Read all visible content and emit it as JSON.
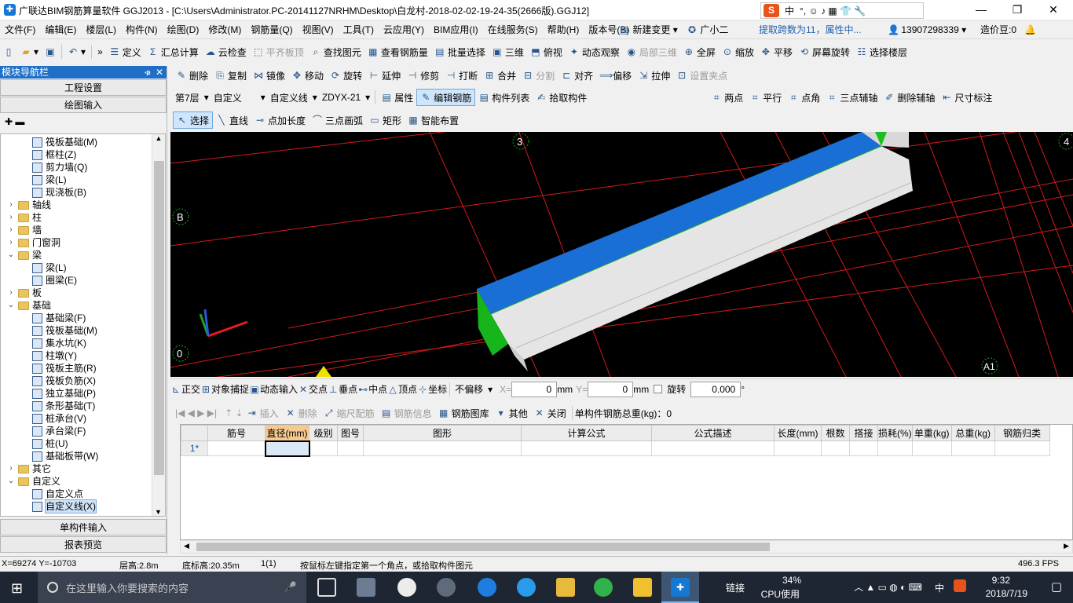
{
  "titlebar": {
    "title": "广联达BIM钢筋算量软件 GGJ2013 - [C:\\Users\\Administrator.PC-20141127NRHM\\Desktop\\白龙村-2018-02-02-19-24-35(2666版).GGJ12]",
    "ime_label": "中",
    "ime_extra": "°, ☺ ♪ ▦ 👕 🔧",
    "min": "—",
    "max": "❐",
    "close": "✕"
  },
  "menubar": {
    "items": [
      "文件(F)",
      "编辑(E)",
      "楼层(L)",
      "构件(N)",
      "绘图(D)",
      "修改(M)",
      "钢筋量(Q)",
      "视图(V)",
      "工具(T)",
      "云应用(Y)",
      "BIM应用(I)",
      "在线服务(S)",
      "帮助(H)",
      "版本号(B)"
    ],
    "new_change": "新建变更",
    "assistant": "广小二",
    "notice": "提取跨数为11，属性中...",
    "phone": "13907298339",
    "cost_bean": "造价豆:0"
  },
  "toolbar1": {
    "items": [
      "定义",
      "汇总计算",
      "云检查",
      "平齐板顶",
      "查找图元",
      "查看钢筋量",
      "批量选择",
      "三维",
      "俯视",
      "动态观察",
      "局部三维",
      "全屏",
      "缩放",
      "平移",
      "屏幕旋转",
      "选择楼层"
    ]
  },
  "toolbar2": {
    "items": [
      "删除",
      "复制",
      "镜像",
      "移动",
      "旋转",
      "延伸",
      "修剪",
      "打断",
      "合并",
      "分割",
      "对齐",
      "偏移",
      "拉伸",
      "设置夹点"
    ]
  },
  "toolbar3": {
    "floor": "第7层",
    "category": "自定义",
    "type": "自定义线",
    "component": "ZDYX-21",
    "items": [
      "属性",
      "编辑钢筋",
      "构件列表",
      "拾取构件"
    ],
    "snap_items": [
      "两点",
      "平行",
      "点角",
      "三点辅轴",
      "删除辅轴",
      "尺寸标注"
    ]
  },
  "toolbar4": {
    "items": [
      "选择",
      "直线",
      "点加长度",
      "三点画弧",
      "矩形",
      "智能布置"
    ]
  },
  "nav": {
    "title": "模块导航栏",
    "pin": "ቁ",
    "close": "✕",
    "project_settings": "工程设置",
    "drawing_input": "绘图输入",
    "single_input": "单构件输入",
    "report_preview": "报表预览",
    "tree": [
      {
        "label": "筏板基础(M)",
        "level": 3
      },
      {
        "label": "框柱(Z)",
        "level": 3
      },
      {
        "label": "剪力墙(Q)",
        "level": 3
      },
      {
        "label": "梁(L)",
        "level": 3
      },
      {
        "label": "现浇板(B)",
        "level": 3
      },
      {
        "label": "轴线",
        "level": 1
      },
      {
        "label": "柱",
        "level": 1
      },
      {
        "label": "墙",
        "level": 1
      },
      {
        "label": "门窗洞",
        "level": 1
      },
      {
        "label": "梁",
        "level": 1
      },
      {
        "label": "梁(L)",
        "level": 3
      },
      {
        "label": "圈梁(E)",
        "level": 3
      },
      {
        "label": "板",
        "level": 1
      },
      {
        "label": "基础",
        "level": 1
      },
      {
        "label": "基础梁(F)",
        "level": 3
      },
      {
        "label": "筏板基础(M)",
        "level": 3
      },
      {
        "label": "集水坑(K)",
        "level": 3
      },
      {
        "label": "柱墩(Y)",
        "level": 3
      },
      {
        "label": "筏板主筋(R)",
        "level": 3
      },
      {
        "label": "筏板负筋(X)",
        "level": 3
      },
      {
        "label": "独立基础(P)",
        "level": 3
      },
      {
        "label": "条形基础(T)",
        "level": 3
      },
      {
        "label": "桩承台(V)",
        "level": 3
      },
      {
        "label": "承台梁(F)",
        "level": 3
      },
      {
        "label": "桩(U)",
        "level": 3
      },
      {
        "label": "基础板带(W)",
        "level": 3
      },
      {
        "label": "其它",
        "level": 1
      },
      {
        "label": "自定义",
        "level": 1
      },
      {
        "label": "自定义点",
        "level": 3
      },
      {
        "label": "自定义线(X)",
        "level": 3
      }
    ]
  },
  "viewport": {
    "axis_labels": [
      "3",
      "B",
      "0",
      "4",
      "A1"
    ]
  },
  "snapbar": {
    "items": [
      "正交",
      "对象捕捉",
      "动态输入",
      "交点",
      "垂点",
      "中点",
      "顶点",
      "坐标"
    ],
    "offset_mode": "不偏移",
    "x_label": "X=",
    "x_value": "0",
    "y_label": "Y=",
    "y_value": "0",
    "unit": "mm",
    "rotate_label": "旋转",
    "rotate_value": "0.000",
    "degree": "°"
  },
  "rebarbar": {
    "items": [
      "插入",
      "删除",
      "缩尺配筋",
      "钢筋信息",
      "钢筋图库",
      "其他",
      "关闭"
    ],
    "total": "单构件钢筋总重(kg)：0"
  },
  "grid": {
    "columns": [
      "筋号",
      "直径(mm)",
      "级别",
      "图号",
      "图形",
      "计算公式",
      "公式描述",
      "长度(mm)",
      "根数",
      "搭接",
      "损耗(%)",
      "单重(kg)",
      "总重(kg)",
      "钢筋归类"
    ],
    "rows": [
      {
        "index": "1*"
      }
    ]
  },
  "statusbar": {
    "coords": "X=69274 Y=-10703",
    "floor_height": "层高:2.8m",
    "base_height": "底标高:20.35m",
    "count": "1(1)",
    "hint": "按鼠标左键指定第一个角点，或拾取构件图元",
    "fps": "496.3 FPS"
  },
  "taskbar": {
    "search_placeholder": "在这里输入你要搜索的内容",
    "link": "链接",
    "cpu_pct": "34%",
    "cpu_label": "CPU使用",
    "lang": "中",
    "time": "9:32",
    "date": "2018/7/19"
  }
}
